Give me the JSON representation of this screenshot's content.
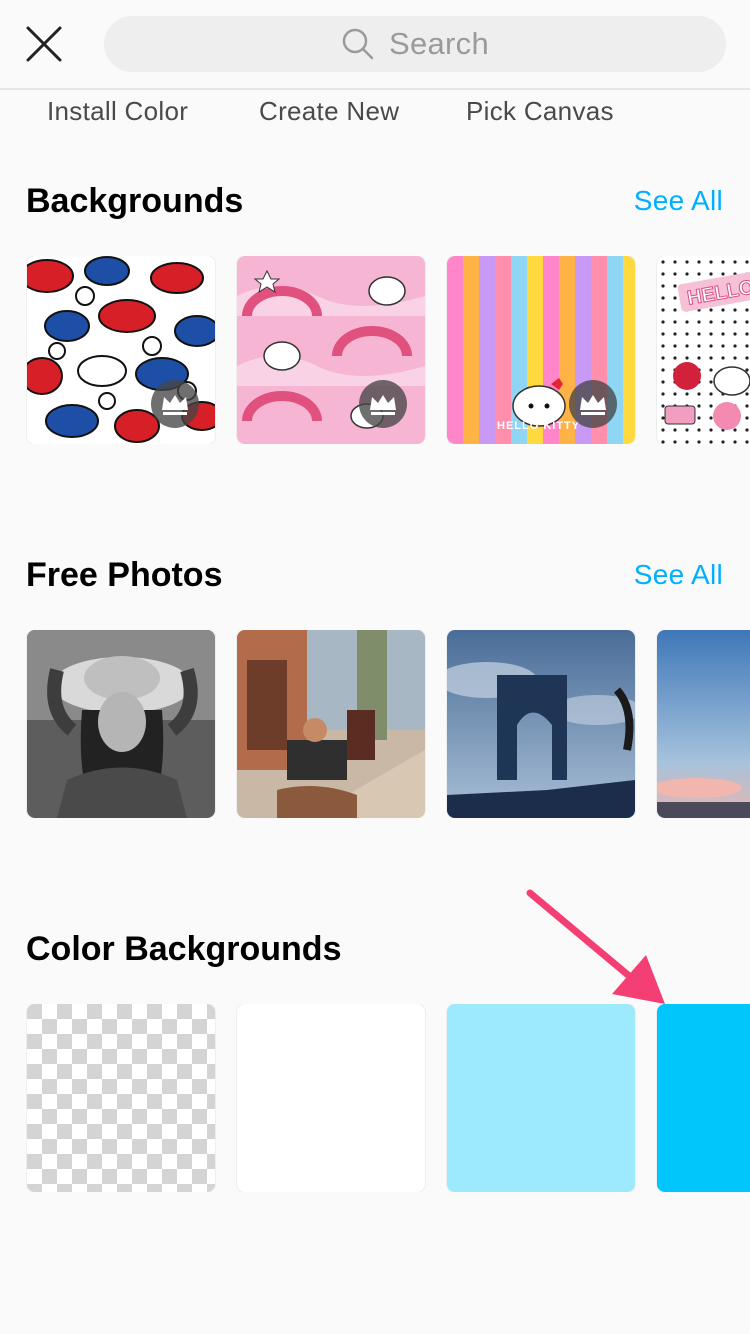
{
  "header": {
    "search_placeholder": "Search",
    "close_icon": "close-icon",
    "search_icon": "search-icon"
  },
  "quick_tabs": [
    "Install Color",
    "Create New",
    "Pick Canvas"
  ],
  "sections": {
    "backgrounds": {
      "title": "Backgrounds",
      "see_all": "See All"
    },
    "free_photos": {
      "title": "Free Photos",
      "see_all": "See All"
    },
    "color_backgrounds": {
      "title": "Color Backgrounds"
    }
  },
  "thumb_text": {
    "kitty_label": "HELLO KITTY",
    "hello_label": "HELLO"
  },
  "colors": {
    "accent": "#00b0ff",
    "light_blue": "#9eeafd",
    "bright_blue": "#00c6fb",
    "arrow": "#f43f75"
  }
}
